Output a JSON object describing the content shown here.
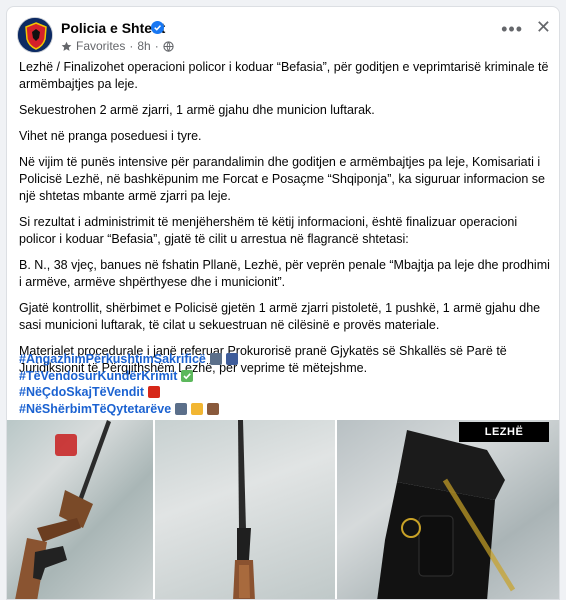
{
  "post": {
    "page_name": "Policia e Shtetit",
    "favorites_label": "Favorites",
    "time": "8h",
    "paragraphs": [
      "Lezhë / Finalizohet operacioni policor i koduar “Befasia”, për goditjen e veprimtarisë kriminale të armëmbajtjes pa leje.",
      "Sekuestrohen 2 armë zjarri, 1 armë gjahu dhe municion luftarak.",
      "Vihet në pranga poseduesi i tyre.",
      "Në vijim të punës intensive për parandalimin dhe goditjen e armëmbajtjes pa leje, Komisariati i Policisë Lezhë, në bashkëpunim me Forcat e Posaçme “Shqiponja”, ka siguruar informacion se një shtetas mbante armë zjarri pa leje.",
      "Si rezultat i administrimit të menjëhershëm të këtij informacioni, është finalizuar operacioni policor i koduar “Befasia”, gjatë të cilit u arrestua në flagrancë shtetasi:",
      "B. N., 38 vjeç, banues në fshatin Pllanë, Lezhë, për veprën penale “Mbajtja pa leje dhe prodhimi i armëve, armëve shpërthyese dhe i municionit”.",
      "Gjatë kontrollit, shërbimet e Policisë gjetën 1 armë zjarri pistoletë, 1 pushkë, 1 armë gjahu dhe sasi municioni luftarak, të cilat u sekuestruan në cilësinë e provës materiale.",
      "Materialet procedurale i janë referuar Prokurorisë pranë Gjykatës së Shkallës së Parë të Juridiksionit të Përgjithshëm Lezhë, për veprime të mëtejshme."
    ],
    "hashtags": [
      "#AngazhimPërkushtimSakrificë",
      "#TëVendosurKundërKrimit",
      "#NëÇdoSkajTëVendit",
      "#NëShërbimTëQytetarëve"
    ],
    "photo_caption": "LEZHË"
  },
  "icons": {
    "avatar": "police-badge-avatar",
    "verified": "verified-badge-icon",
    "favorites": "star-icon",
    "privacy": "globe-icon",
    "more": "more-options-icon",
    "close": "close-icon"
  },
  "colors": {
    "hashtag": "#1b62d1",
    "verified": "#1877f2",
    "meta": "#65676b"
  }
}
